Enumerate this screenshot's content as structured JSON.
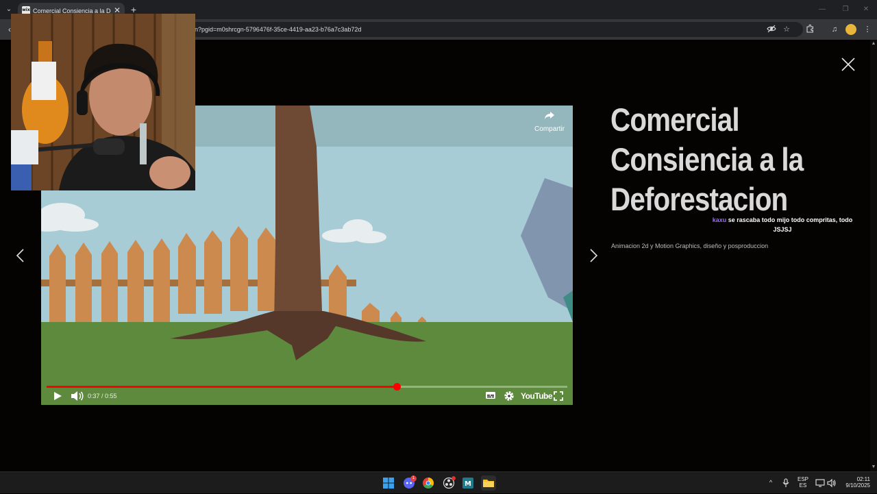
{
  "browser": {
    "tab_title": "Comercial Consiencia a la Deforestacion",
    "tab_favicon_text": "wix",
    "url": "n?pgid=m0shrcgn-5796476f-35ce-4419-aa23-b76a7c3ab72d"
  },
  "icons": {
    "tab_menu": "chevron-down-icon",
    "tab_close": "close-icon",
    "new_tab": "plus-icon",
    "back": "arrow-left-icon",
    "eye_off": "eye-off-icon",
    "star": "star-icon",
    "extensions": "puzzle-icon",
    "media": "media-control-icon",
    "menu": "kebab-menu-icon"
  },
  "lightbox": {
    "close_label": "close",
    "prev_label": "previous",
    "next_label": "next"
  },
  "video": {
    "share_label": "Compartir",
    "current_time": "0:37",
    "duration": "0:55",
    "time_display": "0:37 / 0:55",
    "progress": 0.673,
    "brand": "YouTube"
  },
  "project": {
    "title_lines": [
      "Comercial",
      "Consiencia a la",
      "Deforestacion"
    ],
    "description": "Animacion 2d y Motion Graphics, diseño y posproduccion"
  },
  "chat_overlay": {
    "user": "kaxu",
    "message": " se rascaba todo mijo todo compritas, todo JSJSJ"
  },
  "taskbar": {
    "lang_top": "ESP",
    "lang_bottom": "ES",
    "time": "02:11",
    "date": "9/10/2025",
    "discord_badge": "1"
  },
  "colors": {
    "page_bg": "#050302",
    "title_color": "#d9d9d9",
    "progress_red": "#ff0000",
    "chrome_dark": "#1f2023",
    "chrome_mid": "#35363a"
  }
}
